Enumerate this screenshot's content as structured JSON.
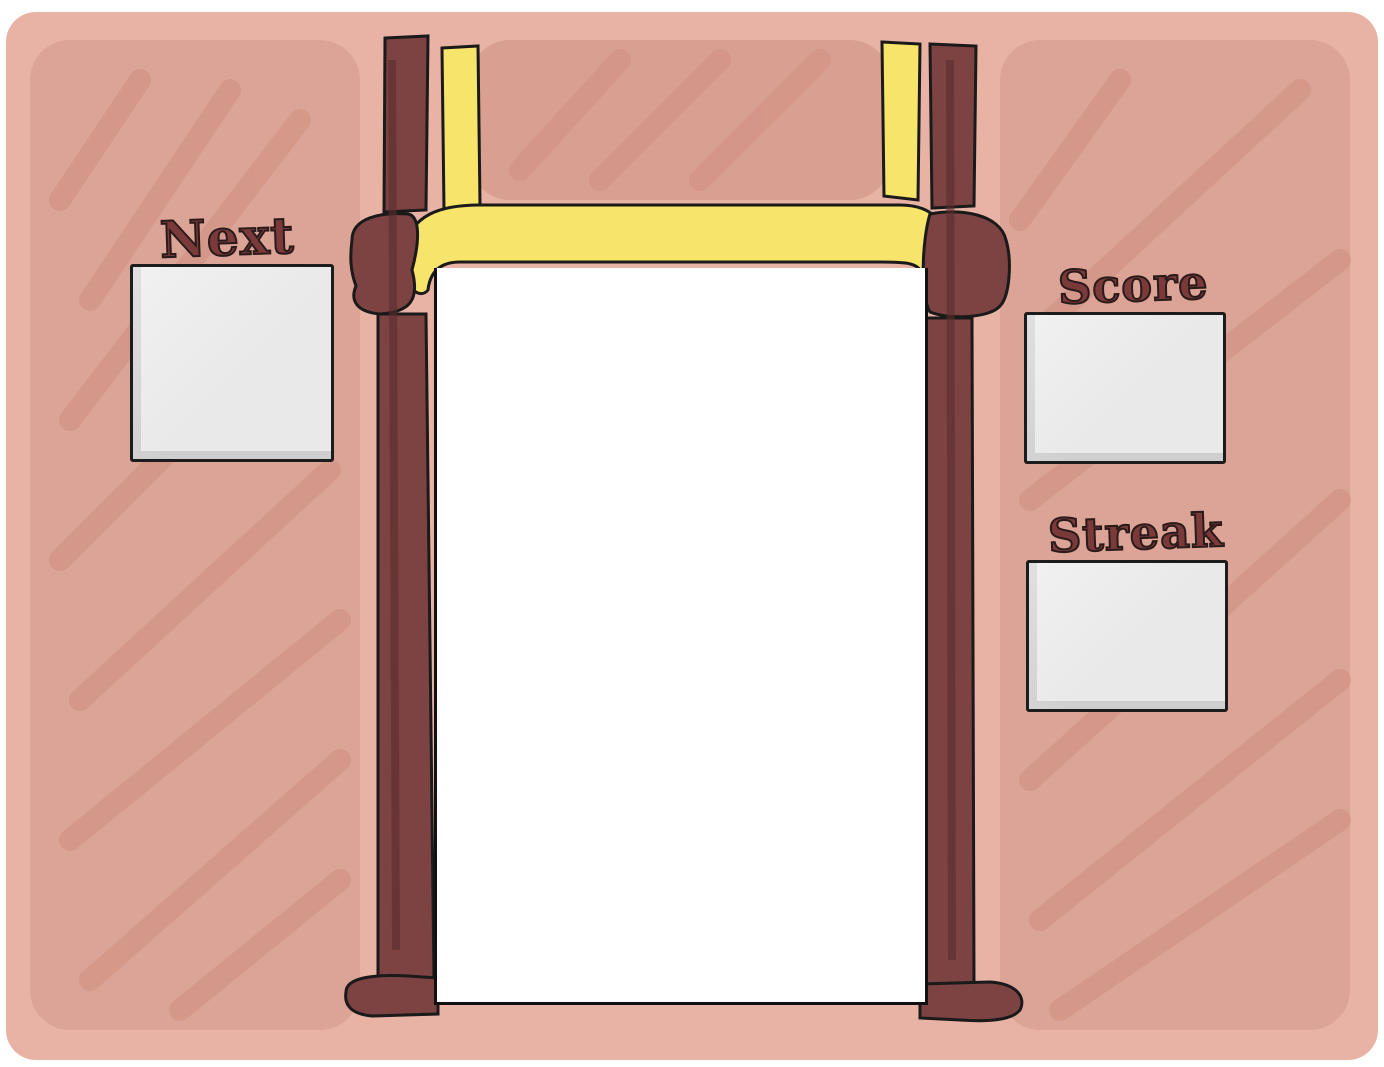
{
  "game": {
    "labels": {
      "next": "Next",
      "score": "Score",
      "streak": "Streak"
    },
    "values": {
      "next": "",
      "score": "",
      "streak": ""
    }
  },
  "colors": {
    "background": "#d9a294",
    "background_light": "#eab4a6",
    "pillar": "#7d4242",
    "pillar_dark": "#4e2424",
    "rail": "#f7e46b",
    "panel": "#e9e9e9",
    "outline": "#1c1c1c"
  }
}
